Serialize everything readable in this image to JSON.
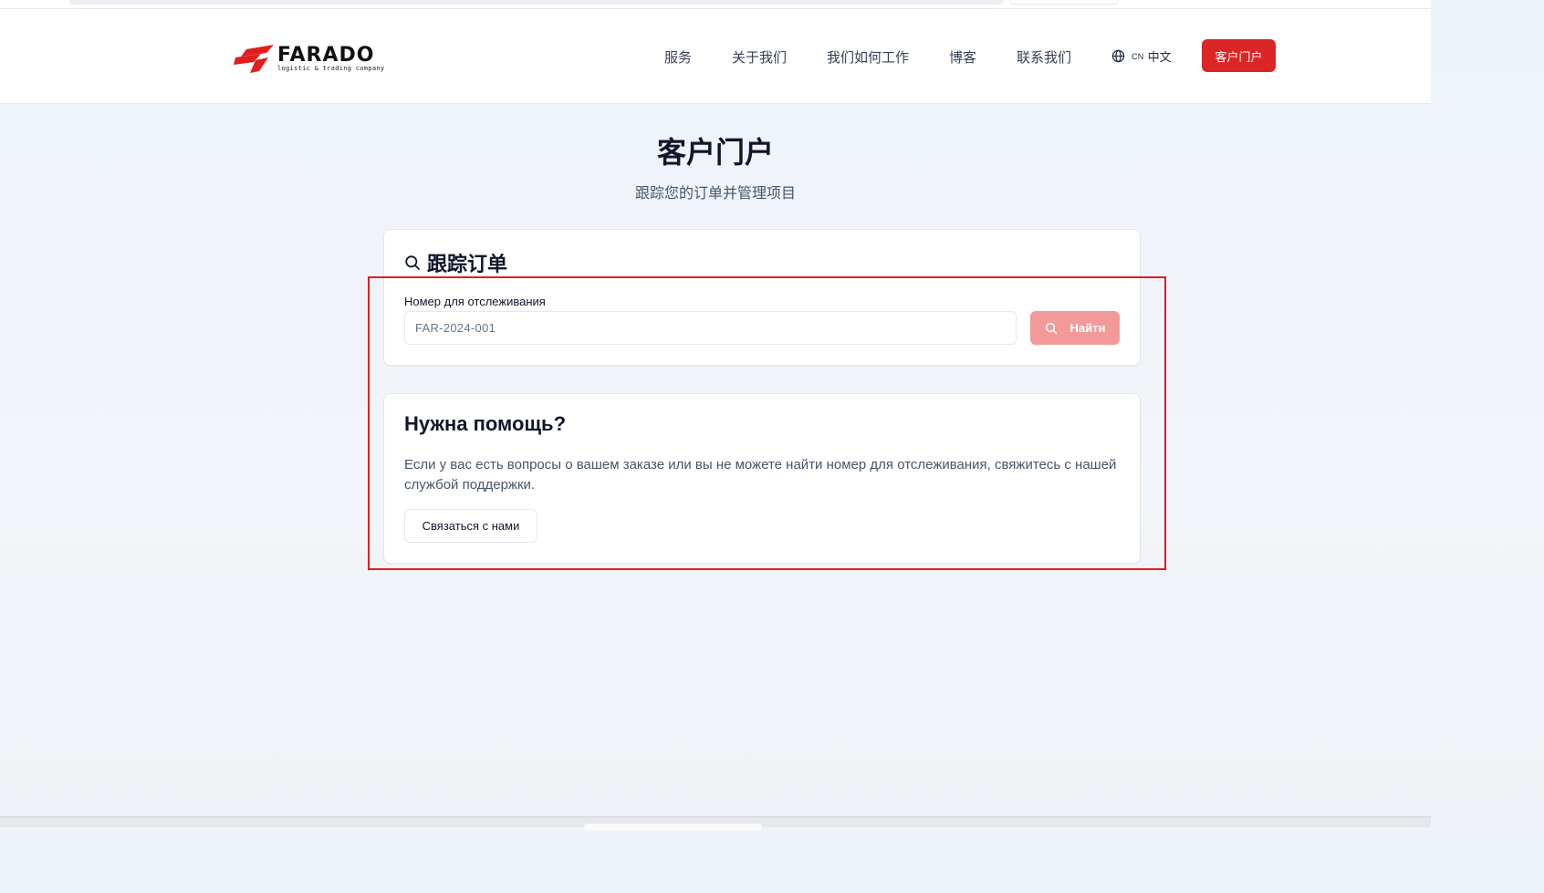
{
  "brand": {
    "name": "FARADO",
    "tagline": "logistic & trading company",
    "accent_color": "#dc2626"
  },
  "nav": {
    "items": [
      "服务",
      "关于我们",
      "我们如何工作",
      "博客",
      "联系我们"
    ],
    "language": {
      "code": "CN",
      "label": "中文",
      "icon": "globe-icon"
    },
    "portal_button": "客户门户"
  },
  "page": {
    "title": "客户门户",
    "subtitle": "跟踪您的订单并管理项目"
  },
  "track": {
    "title": "跟踪订单",
    "icon": "search-icon",
    "field_label": "Номер для отслеживания",
    "placeholder": "FAR-2024-001",
    "value": "",
    "button_label": "Найти",
    "button_color": "#f29999"
  },
  "help": {
    "title": "Нужна помощь?",
    "text": "Если у вас есть вопросы о вашем заказе или вы не можете найти номер для отслеживания, свяжитесь с нашей службой поддержки.",
    "button_label": "Связаться с нами"
  },
  "annotation": {
    "highlight_color": "#e11d1d"
  }
}
